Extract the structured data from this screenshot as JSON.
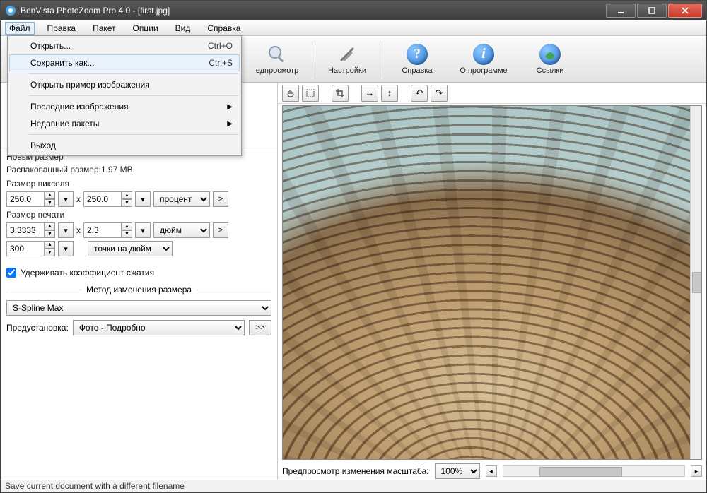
{
  "titlebar": {
    "title": "BenVista PhotoZoom Pro 4.0 - [first.jpg]"
  },
  "menubar": [
    "Файл",
    "Правка",
    "Пакет",
    "Опции",
    "Вид",
    "Справка"
  ],
  "file_menu": {
    "open": "Открыть...",
    "open_sc": "Ctrl+O",
    "saveas": "Сохранить как...",
    "saveas_sc": "Ctrl+S",
    "open_sample": "Открыть пример изображения",
    "recent_images": "Последние изображения",
    "recent_batches": "Недавние пакеты",
    "exit": "Выход"
  },
  "toolbar": {
    "preview": "едпросмотр",
    "settings": "Настройки",
    "help": "Справка",
    "about": "О программе",
    "links": "Ссылки"
  },
  "left": {
    "new_size": "Новый размер",
    "unpacked": "Распакованный размер:1.97 MB",
    "pixel_size": "Размер пикселя",
    "px_w": "250.0",
    "px_h": "250.0",
    "times": "x",
    "unit_percent": "процент",
    "print_size": "Размер печати",
    "pr_w": "3.3333",
    "pr_h": "2.3",
    "unit_inch": "дюйм",
    "dpi": "300",
    "unit_dpi": "точки на дюйм",
    "keep_ratio": "Удерживать коэффициент сжатия",
    "resize_method": "Метод изменения размера",
    "method_val": "S-Spline Max",
    "preset_label": "Предустановка:",
    "preset_val": "Фото - Подробно",
    "more": ">>",
    "arrow_btn": ">"
  },
  "preview_bar": {
    "label": "Предпросмотр изменения масштаба:",
    "zoom": "100%"
  },
  "status": "Save current document with a different filename"
}
